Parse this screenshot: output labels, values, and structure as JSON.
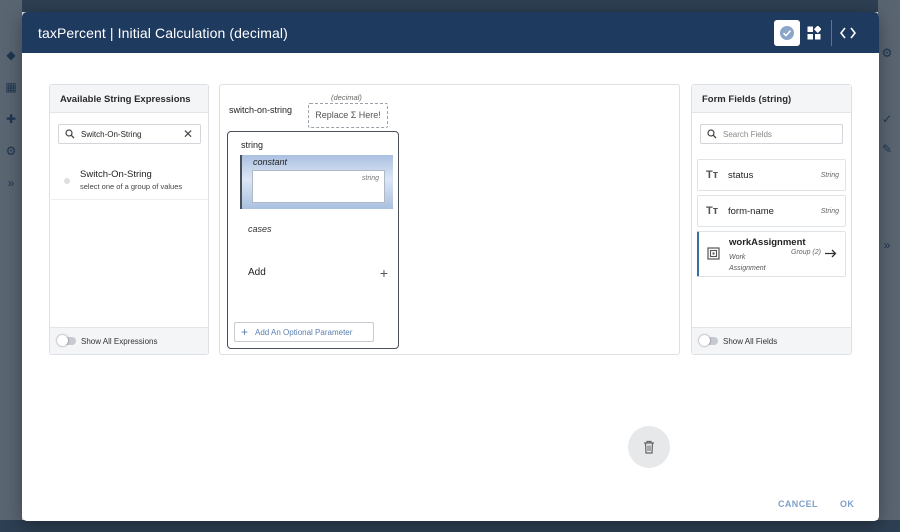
{
  "modal": {
    "title": "taxPercent | Initial Calculation (decimal)",
    "header_buttons": [
      "check-icon",
      "widgets-icon",
      "code-icon"
    ]
  },
  "left_panel": {
    "title": "Available String Expressions",
    "search_value": "Switch-On-String",
    "items": [
      {
        "title": "Switch-On-String",
        "subtitle": "select one of a group of values"
      }
    ],
    "footer_label": "Show All Expressions"
  },
  "middle_panel": {
    "function_name": "switch-on-string",
    "return_type_label": "(decimal)",
    "replace_label": "Replace Σ Here!",
    "switch": {
      "param_type": "string",
      "constant_label": "constant",
      "constant_type": "string",
      "cases_label": "cases",
      "add_label": "Add",
      "add_symbol": "+",
      "optional_param_label": "Add An Optional Parameter"
    }
  },
  "right_panel": {
    "title": "Form Fields (string)",
    "search_placeholder": "Search Fields",
    "fields": [
      {
        "icon": "Tт",
        "name": "status",
        "type": "String"
      },
      {
        "icon": "Tт",
        "name": "form-name",
        "type": "String"
      },
      {
        "name": "workAssignment",
        "subtitle_line1": "Work",
        "subtitle_line2": "Assignment",
        "type": "Group (2)"
      }
    ],
    "footer_label": "Show All Fields"
  },
  "footer": {
    "cancel_label": "CANCEL",
    "ok_label": "OK"
  },
  "colors": {
    "header_bg": "#1e3a5f",
    "accent_link": "#7fa0c8",
    "selected_border": "#3b6fa3"
  }
}
